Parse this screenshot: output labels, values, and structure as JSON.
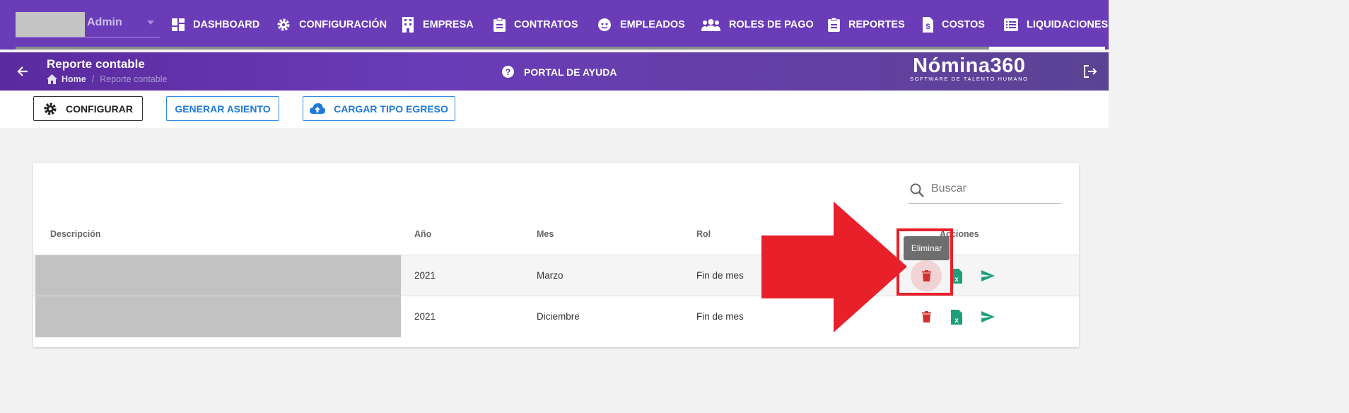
{
  "user": {
    "name": "Admin"
  },
  "nav": {
    "items": [
      {
        "label": "DASHBOARD",
        "icon": "dashboard-icon"
      },
      {
        "label": "CONFIGURACIÓN",
        "icon": "gear-icon"
      },
      {
        "label": "EMPRESA",
        "icon": "building-icon"
      },
      {
        "label": "CONTRATOS",
        "icon": "clipboard-icon"
      },
      {
        "label": "EMPLEADOS",
        "icon": "face-icon"
      },
      {
        "label": "ROLES DE PAGO",
        "icon": "people-icon"
      },
      {
        "label": "REPORTES",
        "icon": "clipboard-icon"
      },
      {
        "label": "COSTOS",
        "icon": "dollar-file-icon"
      },
      {
        "label": "LIQUIDACIONES",
        "icon": "list-icon"
      }
    ]
  },
  "header": {
    "title": "Reporte contable",
    "breadcrumb": {
      "home": "Home",
      "separator": "/",
      "current": "Reporte contable"
    },
    "help": "PORTAL DE AYUDA",
    "logo_main": "Nómina360",
    "logo_sub": "SOFTWARE DE TALENTO HUMANO"
  },
  "toolbar": {
    "configurar": "CONFIGURAR",
    "generar": "GENERAR ASIENTO",
    "cargar": "CARGAR TIPO EGRESO"
  },
  "search": {
    "placeholder": "Buscar"
  },
  "table": {
    "headers": {
      "descripcion": "Descripción",
      "anio": "Año",
      "mes": "Mes",
      "rol": "Rol",
      "acciones": "Acciones"
    },
    "rows": [
      {
        "anio": "2021",
        "mes": "Marzo",
        "rol": "Fin de mes"
      },
      {
        "anio": "2021",
        "mes": "Diciembre",
        "rol": "Fin de mes"
      }
    ]
  },
  "tooltip": {
    "text": "Eliminar"
  },
  "colors": {
    "nav": "#6a3cb8",
    "primary_blue": "#1e7ad8",
    "delete_red": "#d32f2f",
    "excel_green": "#1e9e7a",
    "annotation_red": "#e8202a"
  }
}
